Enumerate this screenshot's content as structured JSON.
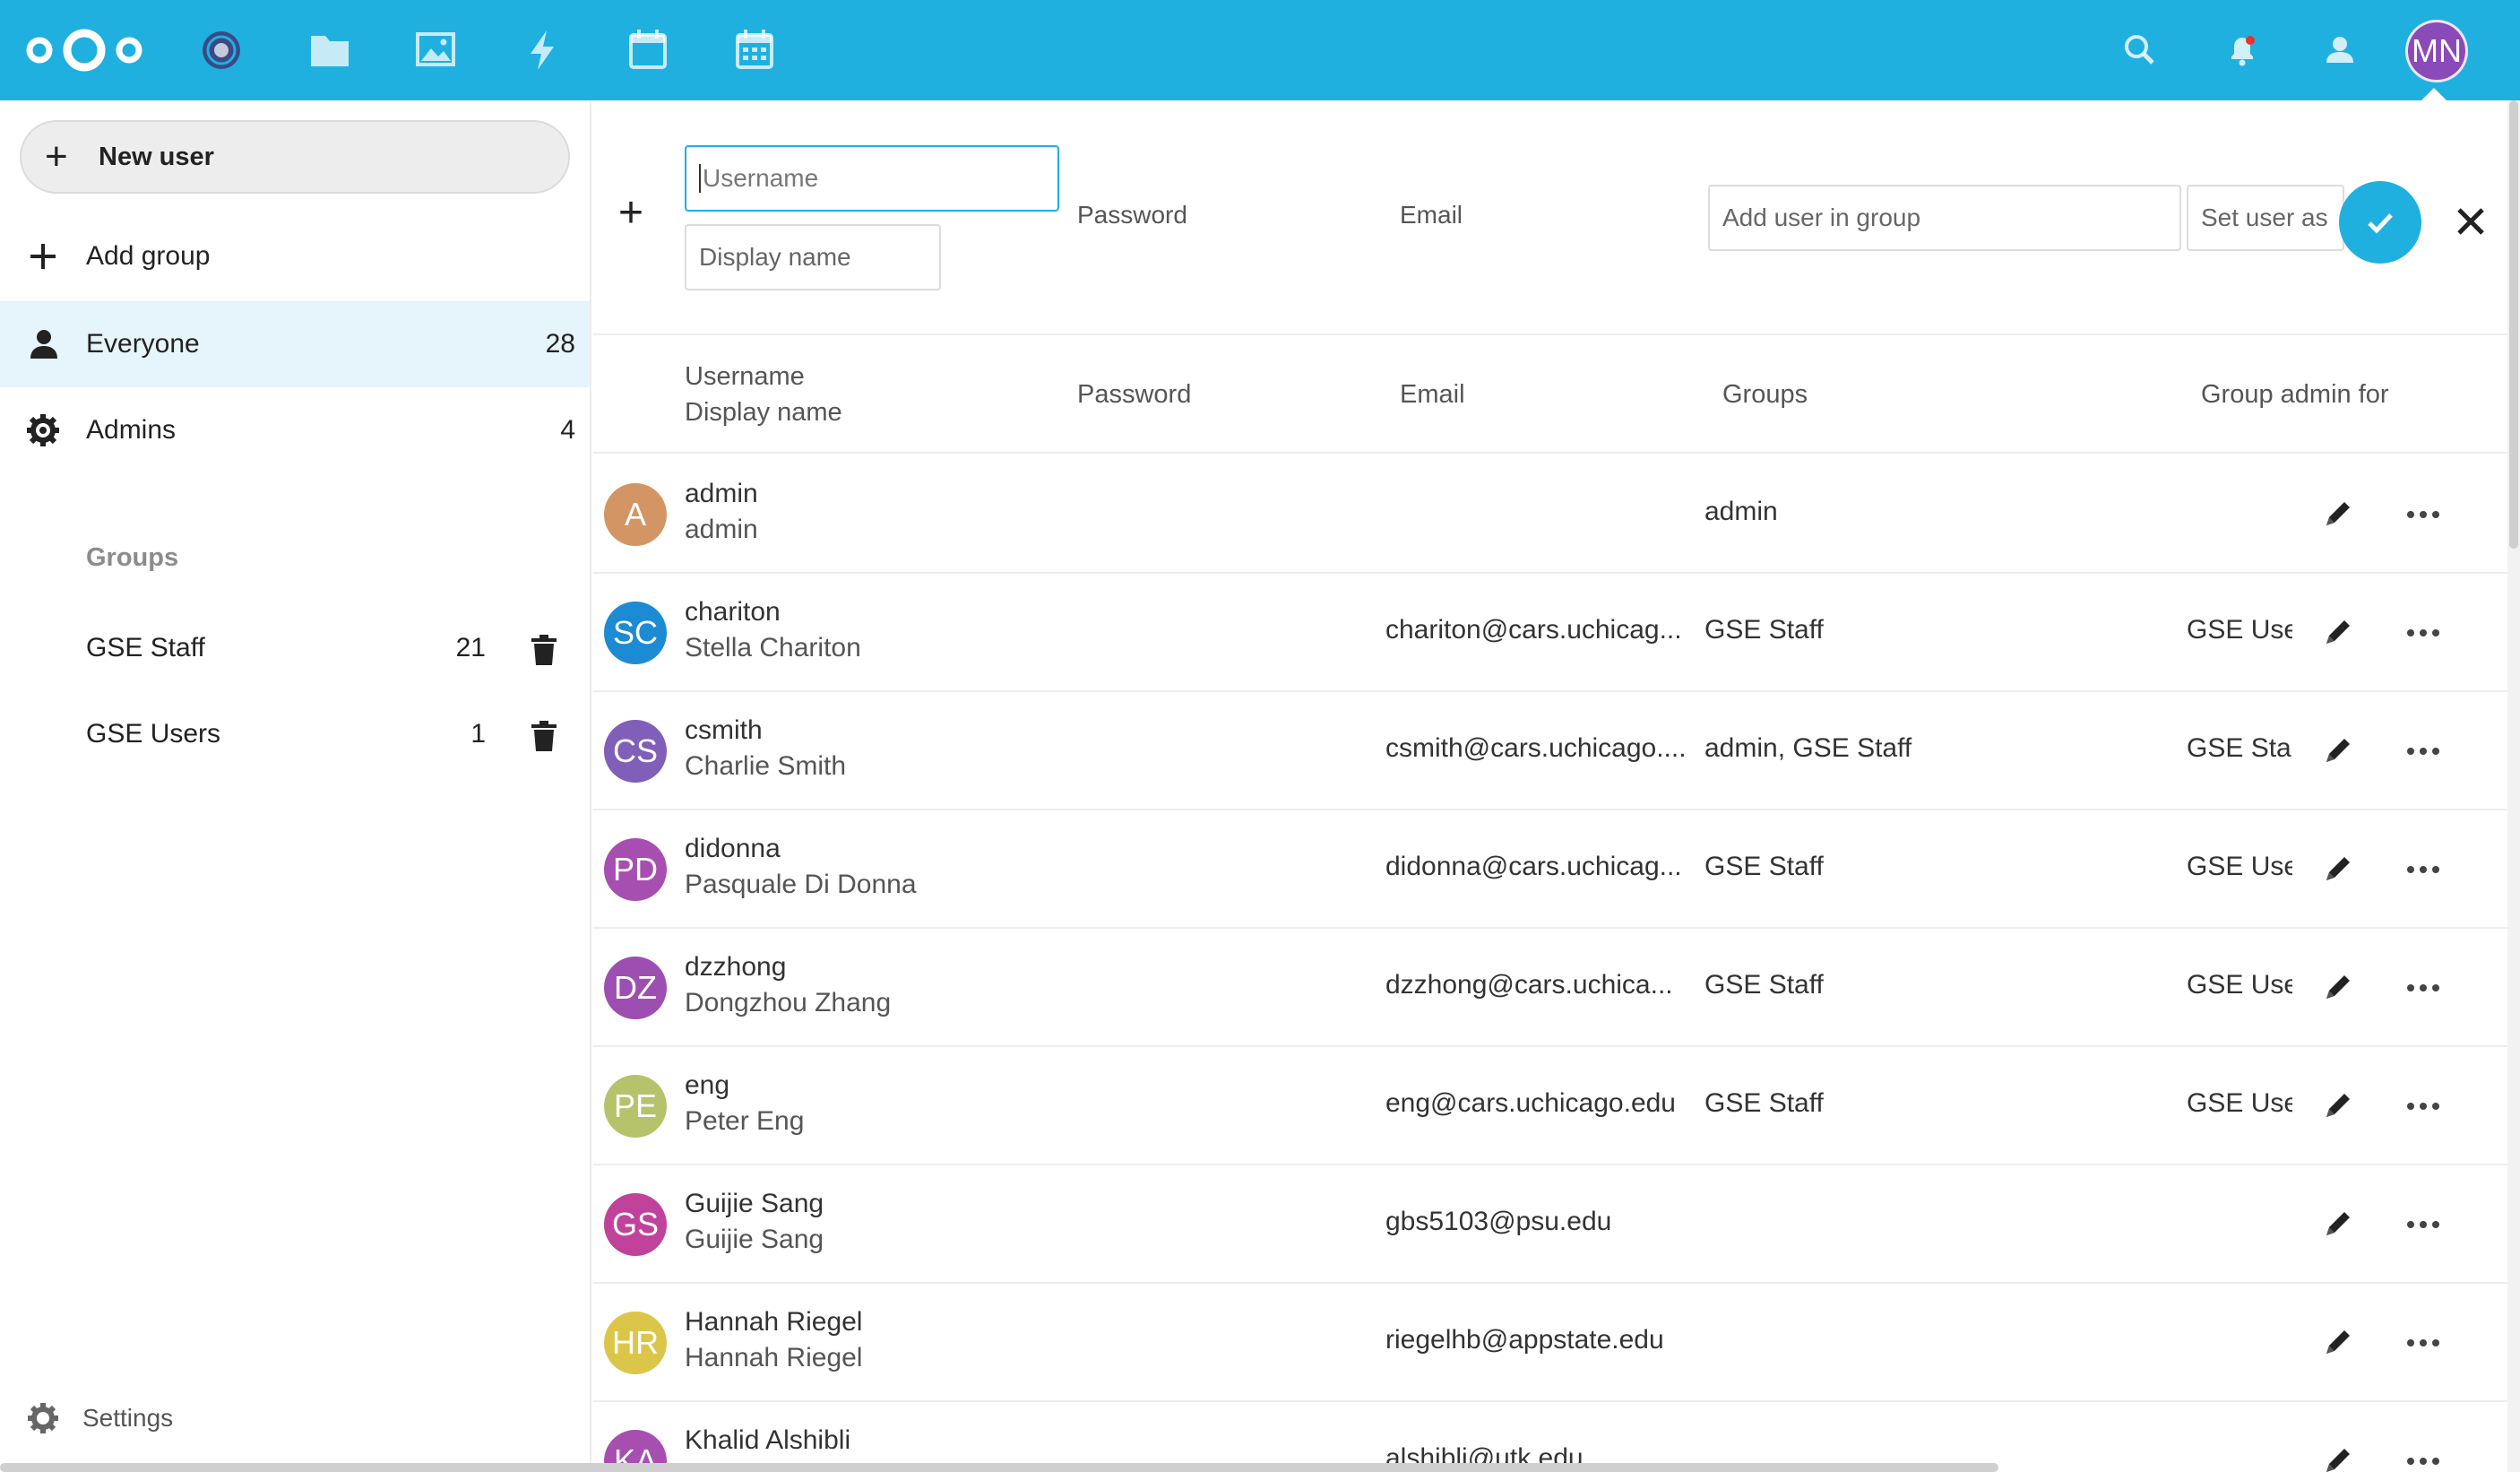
{
  "header": {
    "accent": "#1fb0e0",
    "apps": [
      "dashboard-icon",
      "files-icon",
      "photos-icon",
      "activity-icon",
      "calendar-icon",
      "deck-icon"
    ],
    "avatar_initials": "MN",
    "avatar_color": "#8a4ab8"
  },
  "sidebar": {
    "new_user_label": "New user",
    "add_group_label": "Add group",
    "everyone": {
      "label": "Everyone",
      "count": "28"
    },
    "admins": {
      "label": "Admins",
      "count": "4"
    },
    "groups_caption": "Groups",
    "groups": [
      {
        "label": "GSE Staff",
        "count": "21"
      },
      {
        "label": "GSE Users",
        "count": "1"
      }
    ],
    "settings_label": "Settings"
  },
  "new_user_form": {
    "username_placeholder": "Username",
    "display_name_placeholder": "Display name",
    "password_label": "Password",
    "email_label": "Email",
    "group_placeholder": "Add user in group",
    "set_admin_placeholder": "Set user as"
  },
  "table": {
    "headers": {
      "username": "Username",
      "display_name": "Display name",
      "password": "Password",
      "email": "Email",
      "groups": "Groups",
      "group_admin": "Group admin for"
    },
    "rows": [
      {
        "initials": "A",
        "color": "#d39563",
        "username": "admin",
        "display": "admin",
        "email": "",
        "groups": "admin",
        "admin_for": ""
      },
      {
        "initials": "SC",
        "color": "#1d8bd3",
        "username": "chariton",
        "display": "Stella Chariton",
        "email": "chariton@cars.uchicag...",
        "groups": "GSE Staff",
        "admin_for": "GSE Use"
      },
      {
        "initials": "CS",
        "color": "#7f5fb8",
        "username": "csmith",
        "display": "Charlie Smith",
        "email": "csmith@cars.uchicago....",
        "groups": "admin, GSE Staff",
        "admin_for": "GSE Sta"
      },
      {
        "initials": "PD",
        "color": "#a64fb0",
        "username": "didonna",
        "display": "Pasquale Di Donna",
        "email": "didonna@cars.uchicag...",
        "groups": "GSE Staff",
        "admin_for": "GSE Use"
      },
      {
        "initials": "DZ",
        "color": "#9c4fb1",
        "username": "dzzhong",
        "display": "Dongzhou Zhang",
        "email": "dzzhong@cars.uchica...",
        "groups": "GSE Staff",
        "admin_for": "GSE Use"
      },
      {
        "initials": "PE",
        "color": "#b6c36b",
        "username": "eng",
        "display": "Peter Eng",
        "email": "eng@cars.uchicago.edu",
        "groups": "GSE Staff",
        "admin_for": "GSE Use"
      },
      {
        "initials": "GS",
        "color": "#c0429a",
        "username": "Guijie Sang",
        "display": "Guijie Sang",
        "email": "gbs5103@psu.edu",
        "groups": "",
        "admin_for": ""
      },
      {
        "initials": "HR",
        "color": "#dcc64a",
        "username": "Hannah Riegel",
        "display": "Hannah Riegel",
        "email": "riegelhb@appstate.edu",
        "groups": "",
        "admin_for": ""
      },
      {
        "initials": "KA",
        "color": "#a64fb0",
        "username": "Khalid Alshibli",
        "display": "",
        "email": "alshibli@utk.edu",
        "groups": "",
        "admin_for": ""
      }
    ]
  }
}
